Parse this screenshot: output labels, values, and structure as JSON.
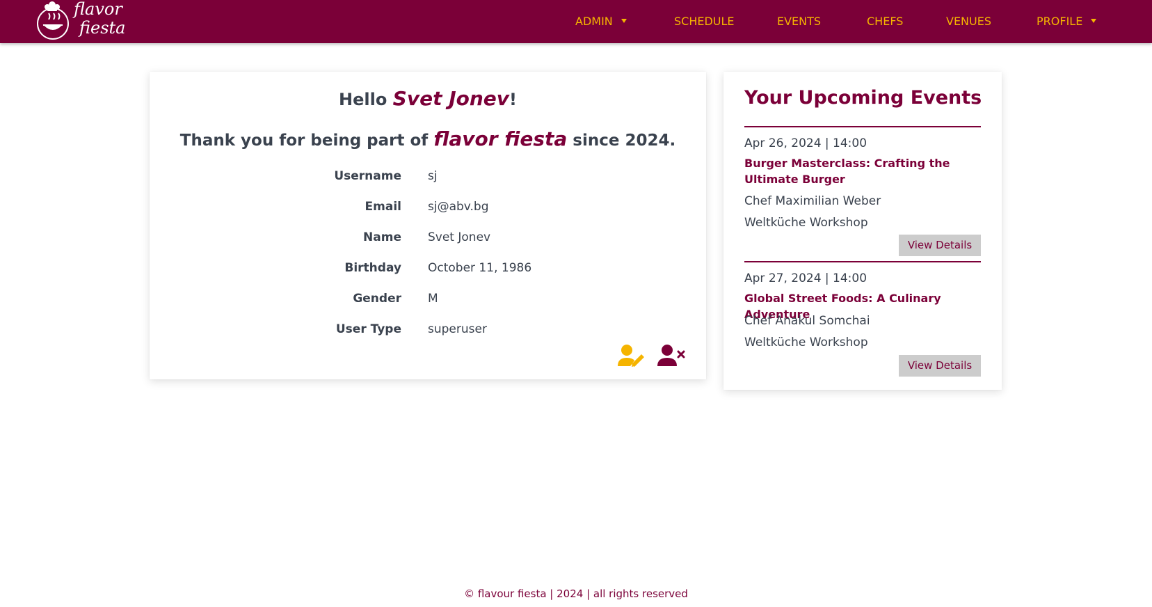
{
  "brand": {
    "logo_line1": "flavor",
    "logo_line2": "fiesta",
    "accent": "#7b0038",
    "nav_color": "#f5b400"
  },
  "nav": {
    "admin": "ADMIN",
    "schedule": "SCHEDULE",
    "events": "EVENTS",
    "chefs": "CHEFS",
    "venues": "VENUES",
    "profile": "PROFILE"
  },
  "profile": {
    "hello_prefix": "Hello ",
    "user_name": "Svet Jonev",
    "hello_suffix": "!",
    "thanks_prefix": "Thank you for being part of ",
    "site_name": "flavor fiesta",
    "thanks_suffix": " since 2024.",
    "fields": [
      {
        "label": "Username",
        "value": "sj"
      },
      {
        "label": "Email",
        "value": "sj@abv.bg"
      },
      {
        "label": "Name",
        "value": "Svet Jonev"
      },
      {
        "label": "Birthday",
        "value": "October 11, 1986"
      },
      {
        "label": "Gender",
        "value": "M"
      },
      {
        "label": "User Type",
        "value": "superuser"
      }
    ],
    "edit_icon": "user-edit-icon",
    "delete_icon": "user-delete-icon"
  },
  "events": {
    "title": "Your Upcoming Events",
    "items": [
      {
        "date": "Apr 26, 2024 | 14:00",
        "title": "Burger Masterclass: Crafting the Ultimate Burger",
        "chef": "Chef Maximilian Weber",
        "venue": "Weltküche Workshop",
        "button": "View Details"
      },
      {
        "date": "Apr 27, 2024 | 14:00",
        "title": "Global Street Foods: A Culinary Adventure",
        "chef": "Chef Anakul Somchai",
        "venue": "Weltküche Workshop",
        "button": "View Details"
      }
    ]
  },
  "footer": {
    "text": "© flavour fiesta | 2024 | all rights reserved"
  }
}
